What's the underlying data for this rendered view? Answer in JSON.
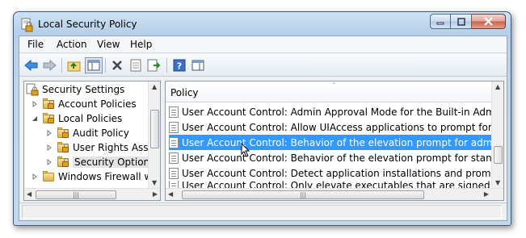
{
  "window": {
    "title": "Local Security Policy"
  },
  "menubar": {
    "items": [
      "File",
      "Action",
      "View",
      "Help"
    ]
  },
  "toolbar": {
    "buttons": [
      "back-icon",
      "forward-icon",
      "up-folder-icon",
      "show-hide-tree-icon",
      "delete-icon",
      "properties-icon",
      "export-list-icon",
      "help-icon",
      "show-hide-action-pane-icon"
    ]
  },
  "tree": {
    "items": [
      {
        "label": "Security Settings",
        "level": 0,
        "expanded": true
      },
      {
        "label": "Account Policies",
        "level": 1,
        "expanded": false
      },
      {
        "label": "Local Policies",
        "level": 1,
        "expanded": true
      },
      {
        "label": "Audit Policy",
        "level": 2,
        "expanded": false
      },
      {
        "label": "User Rights Assig",
        "level": 2,
        "expanded": false
      },
      {
        "label": "Security Options",
        "level": 2,
        "selected": true
      },
      {
        "label": "Windows Firewall w",
        "level": 1,
        "expanded": false
      }
    ]
  },
  "list": {
    "column_header": "Policy",
    "rows": [
      "User Account Control: Admin Approval Mode for the Built-in Administra...",
      "User Account Control: Allow UIAccess applications to prompt for elevati...",
      "User Account Control: Behavior of the elevation prompt for administrato...",
      "User Account Control: Behavior of the elevation prompt for standard user",
      "User Account Control: Detect application installations and prompt for ele...",
      "User Account Control: Only elevate executables that are signed and valid..."
    ],
    "selected_index": 2
  },
  "colors": {
    "selection": "#3399ff",
    "window_frame": "#b6d0ea"
  }
}
